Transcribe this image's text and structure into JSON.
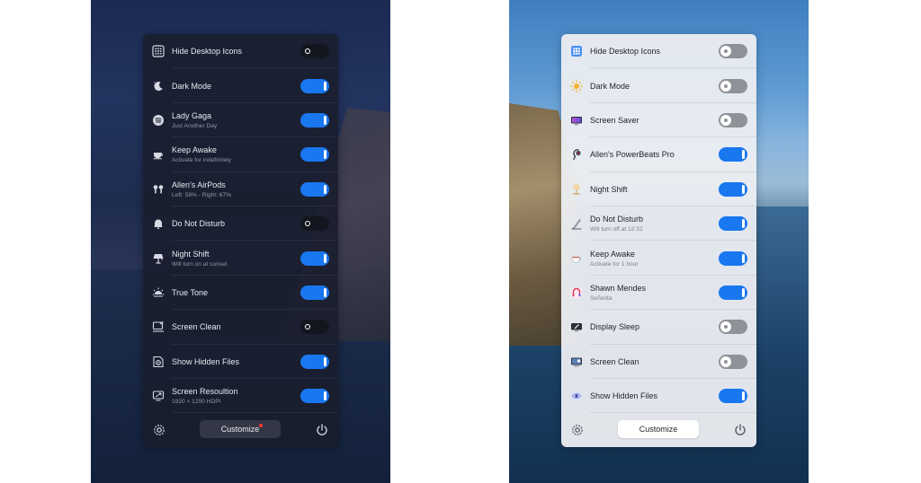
{
  "dark_panel": {
    "items": [
      {
        "title": "Hide Desktop Icons",
        "subtitle": "",
        "enabled": false,
        "icon": "desktop-grid-icon"
      },
      {
        "title": "Dark Mode",
        "subtitle": "",
        "enabled": true,
        "icon": "moon-icon"
      },
      {
        "title": "Lady Gaga",
        "subtitle": "Just Another Day",
        "enabled": true,
        "icon": "music-icon"
      },
      {
        "title": "Keep Awake",
        "subtitle": "Activate for indefinitely",
        "enabled": true,
        "icon": "coffee-cup-icon"
      },
      {
        "title": "Allen's AirPods",
        "subtitle": "Left: 58% - Right: 67%",
        "enabled": true,
        "icon": "airpods-icon"
      },
      {
        "title": "Do Not Disturb",
        "subtitle": "",
        "enabled": false,
        "icon": "bell-icon"
      },
      {
        "title": "Night Shift",
        "subtitle": "Will turn on at sunset",
        "enabled": true,
        "icon": "lamp-icon"
      },
      {
        "title": "True Tone",
        "subtitle": "",
        "enabled": true,
        "icon": "sun-icon"
      },
      {
        "title": "Screen Clean",
        "subtitle": "",
        "enabled": false,
        "icon": "screen-clean-icon"
      },
      {
        "title": "Show Hidden Files",
        "subtitle": "",
        "enabled": true,
        "icon": "eye-file-icon"
      },
      {
        "title": "Screen Resoultion",
        "subtitle": "1920 × 1200 HDPI",
        "enabled": true,
        "icon": "display-resolution-icon"
      }
    ],
    "footer": {
      "customize_label": "Customize",
      "has_badge": true
    }
  },
  "light_panel": {
    "items": [
      {
        "title": "Hide Desktop Icons",
        "subtitle": "",
        "enabled": false,
        "icon": "desktop-grid-icon"
      },
      {
        "title": "Dark Mode",
        "subtitle": "",
        "enabled": false,
        "icon": "sun-icon"
      },
      {
        "title": "Screen Saver",
        "subtitle": "",
        "enabled": false,
        "icon": "screen-saver-icon"
      },
      {
        "title": "Allen's PowerBeats Pro",
        "subtitle": "",
        "enabled": true,
        "icon": "earbud-icon"
      },
      {
        "title": "Night Shift",
        "subtitle": "",
        "enabled": true,
        "icon": "lamp-icon"
      },
      {
        "title": "Do Not Disturb",
        "subtitle": "Will turn off at 12:32",
        "enabled": true,
        "icon": "moon-pencil-icon"
      },
      {
        "title": "Keep Awake",
        "subtitle": "Activate for 1 hour",
        "enabled": true,
        "icon": "coffee-cup-icon"
      },
      {
        "title": "Shawn Mendes",
        "subtitle": "Señorita",
        "enabled": true,
        "icon": "music-icon"
      },
      {
        "title": "Display Sleep",
        "subtitle": "",
        "enabled": false,
        "icon": "display-sleep-icon"
      },
      {
        "title": "Screen Clean",
        "subtitle": "",
        "enabled": false,
        "icon": "screen-clean-icon"
      },
      {
        "title": "Show Hidden Files",
        "subtitle": "",
        "enabled": true,
        "icon": "eye-file-icon"
      }
    ],
    "footer": {
      "customize_label": "Customize",
      "has_badge": false
    }
  },
  "colors": {
    "accent": "#1977f0",
    "badge": "#ff3b30"
  }
}
